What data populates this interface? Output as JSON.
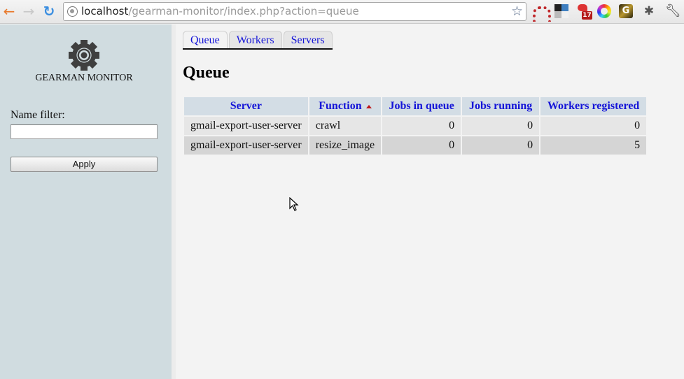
{
  "browser": {
    "url_host": "localhost",
    "url_path": "/gearman-monitor/index.php?action=queue",
    "extensions": [
      "redmine-icon",
      "blocks-icon",
      "bird-icon",
      "color-wheel-icon",
      "g-icon",
      "bug-icon"
    ],
    "bird_badge": "17",
    "extension_g_letter": "G"
  },
  "sidebar": {
    "logo_text": "GEARMAN MONITOR",
    "filter_label": "Name filter:",
    "filter_value": "",
    "apply_label": "Apply"
  },
  "main": {
    "tabs": [
      {
        "label": "Queue",
        "active": true
      },
      {
        "label": "Workers",
        "active": false
      },
      {
        "label": "Servers",
        "active": false
      }
    ],
    "title": "Queue",
    "table": {
      "columns": [
        "Server",
        "Function",
        "Jobs in queue",
        "Jobs running",
        "Workers registered"
      ],
      "sorted_column": "Function",
      "sort_direction": "ascending",
      "rows": [
        {
          "server": "gmail-export-user-server",
          "function": "crawl",
          "jobs_in_queue": "0",
          "jobs_running": "0",
          "workers_registered": "0"
        },
        {
          "server": "gmail-export-user-server",
          "function": "resize_image",
          "jobs_in_queue": "0",
          "jobs_running": "0",
          "workers_registered": "5"
        }
      ]
    }
  },
  "colors": {
    "sidebar_bg": "#d0dce0",
    "link": "#1515d8",
    "header_bg": "#d3dde5",
    "row_odd": "#e6e6e6",
    "row_even": "#d5d5d5",
    "sort_arrow": "#c01818"
  }
}
